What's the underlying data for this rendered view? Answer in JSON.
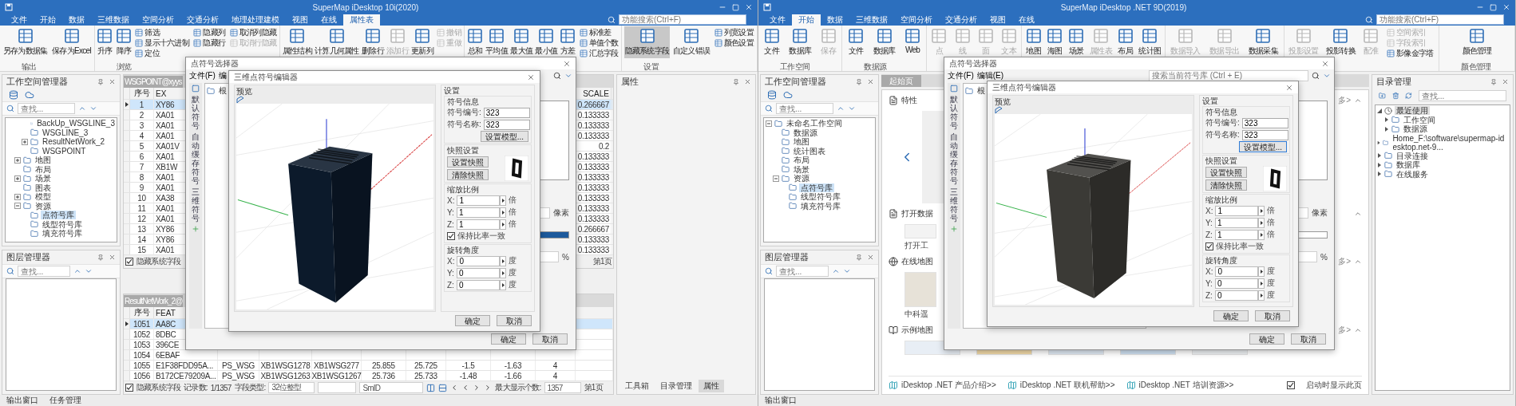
{
  "windows": [
    {
      "kind": "attribute_table",
      "title": "SuperMap iDesktop 10i(2020)",
      "menu_tabs": [
        {
          "label": "文件",
          "selected": false
        },
        {
          "label": "开始",
          "selected": false
        },
        {
          "label": "数据",
          "selected": false
        },
        {
          "label": "三维数据",
          "selected": false
        },
        {
          "label": "空间分析",
          "selected": false
        },
        {
          "label": "交通分析",
          "selected": false
        },
        {
          "label": "地理处理建模",
          "selected": false
        },
        {
          "label": "视图",
          "selected": false
        },
        {
          "label": "在线",
          "selected": false
        },
        {
          "label": "属性表",
          "selected": true
        }
      ],
      "search": {
        "placeholder": "功能搜索(Ctrl+F)"
      },
      "ribbon": [
        {
          "label": "输出",
          "items": [
            {
              "kind": "large",
              "label": "另存为数据集",
              "disabled": false,
              "pressed": false
            },
            {
              "kind": "large",
              "label": "保存为Excel",
              "disabled": false,
              "pressed": false
            }
          ]
        },
        {
          "label": "浏览",
          "items": [
            {
              "kind": "large",
              "label": "升序",
              "disabled": false,
              "pressed": false
            },
            {
              "kind": "large",
              "label": "降序",
              "disabled": false,
              "pressed": false
            },
            {
              "kind": "stack",
              "items": [
                {
                  "label": "筛选",
                  "disabled": false
                },
                {
                  "label": "显示十六进制",
                  "disabled": false
                },
                {
                  "label": "定位",
                  "disabled": false
                }
              ]
            },
            {
              "kind": "stack",
              "items": [
                {
                  "label": "隐藏列",
                  "disabled": false
                },
                {
                  "label": "隐藏行",
                  "disabled": false
                }
              ]
            },
            {
              "kind": "stack",
              "items": [
                {
                  "label": "取消列隐藏",
                  "disabled": false
                },
                {
                  "label": "取消行隐藏",
                  "disabled": true
                }
              ]
            }
          ]
        },
        {
          "items": [
            {
              "kind": "large",
              "label": "属性结构",
              "disabled": false,
              "pressed": false
            },
            {
              "kind": "large",
              "label": "计算几何属性",
              "disabled": false,
              "pressed": false
            },
            {
              "kind": "large",
              "label": "删除行",
              "disabled": false,
              "pressed": false
            },
            {
              "kind": "large",
              "label": "添加行",
              "disabled": true,
              "pressed": false
            },
            {
              "kind": "large",
              "label": "更新列",
              "disabled": false,
              "pressed": false
            },
            {
              "kind": "stack",
              "items": [
                {
                  "label": "撤销",
                  "disabled": true
                },
                {
                  "label": "重做",
                  "disabled": true
                }
              ]
            }
          ]
        },
        {
          "items": [
            {
              "kind": "large",
              "label": "总和",
              "disabled": false,
              "pressed": false
            },
            {
              "kind": "large",
              "label": "平均值",
              "disabled": false,
              "pressed": false
            },
            {
              "kind": "large",
              "label": "最大值",
              "disabled": false,
              "pressed": false
            },
            {
              "kind": "large",
              "label": "最小值",
              "disabled": false,
              "pressed": false
            },
            {
              "kind": "large",
              "label": "方差",
              "disabled": false,
              "pressed": false
            },
            {
              "kind": "stack",
              "items": [
                {
                  "label": "标准差",
                  "disabled": false
                },
                {
                  "label": "单值个数",
                  "disabled": false
                },
                {
                  "label": "汇总字段",
                  "disabled": false
                }
              ]
            }
          ]
        },
        {
          "label": "设置",
          "items": [
            {
              "kind": "large",
              "label": "隐藏系统字段",
              "disabled": false,
              "pressed": true
            },
            {
              "kind": "large",
              "label": "自定义错误",
              "disabled": false,
              "pressed": false
            },
            {
              "kind": "stack",
              "items": [
                {
                  "label": "列宽设置",
                  "disabled": false
                },
                {
                  "label": "颜色设置",
                  "disabled": false
                }
              ]
            }
          ]
        }
      ],
      "workspace_panel": {
        "title": "工作空间管理器",
        "search": {
          "placeholder": "查找..."
        },
        "tree": [
          {
            "children": [
              {
                "children": [
                  {
                    "label": "BackUp_WSGLINE_3",
                    "selected": false
                  },
                  {
                    "label": "WSGLINE_3",
                    "selected": false
                  },
                  {
                    "label": "ResultNetWork_2",
                    "selected": false,
                    "expanded": false
                  },
                  {
                    "label": "WSGPOINT",
                    "selected": false
                  }
                ]
              }
            ]
          },
          {
            "children": [
              {
                "label": "地图",
                "selected": false,
                "expanded": false
              },
              {
                "label": "布局",
                "selected": false
              },
              {
                "label": "场景",
                "selected": false,
                "expanded": false
              },
              {
                "label": "图表",
                "selected": false
              },
              {
                "label": "模型",
                "selected": false,
                "expanded": false
              },
              {
                "label": "资源",
                "selected": false,
                "expanded": true,
                "children": [
                  {
                    "label": "点符号库",
                    "selected": true
                  },
                  {
                    "label": "线型符号库",
                    "selected": false
                  },
                  {
                    "label": "填充符号库",
                    "selected": false
                  }
                ]
              }
            ]
          }
        ]
      },
      "layer_panel": {
        "title": "图层管理器",
        "search": {
          "placeholder": "查找..."
        }
      },
      "center": {
        "tables": [
          {
            "kind": "scale",
            "tab": "WSGPOINT@xyys",
            "columns": [
              "序号",
              "EX",
              "SCALE"
            ],
            "rows": [
              {
                "selected": true,
                "cells": [
                  "1",
                  "XY86",
                  "0.266667"
                ]
              },
              {
                "selected": false,
                "cells": [
                  "2",
                  "XA01",
                  "0.133333"
                ]
              },
              {
                "selected": false,
                "cells": [
                  "3",
                  "XA01",
                  "0.133333"
                ]
              },
              {
                "selected": false,
                "cells": [
                  "4",
                  "XA01",
                  "0.133333"
                ]
              },
              {
                "selected": false,
                "cells": [
                  "5",
                  "XA01V",
                  "0.2"
                ]
              },
              {
                "selected": false,
                "cells": [
                  "6",
                  "XA01",
                  "0.133333"
                ]
              },
              {
                "selected": false,
                "cells": [
                  "7",
                  "XB1W",
                  "0.133333"
                ]
              },
              {
                "selected": false,
                "cells": [
                  "8",
                  "XA01",
                  "0.133333"
                ]
              },
              {
                "selected": false,
                "cells": [
                  "9",
                  "XA01",
                  "0.133333"
                ]
              },
              {
                "selected": false,
                "cells": [
                  "10",
                  "XA38",
                  "0.133333"
                ]
              },
              {
                "selected": false,
                "cells": [
                  "11",
                  "XA01",
                  "0.133333"
                ]
              },
              {
                "selected": false,
                "cells": [
                  "12",
                  "XA01",
                  "0.133333"
                ]
              },
              {
                "selected": false,
                "cells": [
                  "13",
                  "XY86",
                  "0.266667"
                ]
              },
              {
                "selected": false,
                "cells": [
                  "14",
                  "XY86",
                  "0.133333"
                ]
              },
              {
                "selected": false,
                "cells": [
                  "15",
                  "XA01",
                  "0.133333"
                ]
              }
            ],
            "footer": {
              "hide_system_fields": {
                "label": "隐藏系统字段",
                "checked": true
              },
              "page": "第1页"
            }
          },
          {
            "kind": "fields",
            "tab": "ResultNetWork_2@",
            "columns": [
              "序号",
              "FEAT"
            ],
            "rows": [
              {
                "selected": true,
                "cells": [
                  "1051",
                  "AA8C"
                ]
              },
              {
                "selected": false,
                "cells": [
                  "1052",
                  "8DBC"
                ]
              },
              {
                "selected": false,
                "cells": [
                  "1053",
                  "396CE"
                ]
              },
              {
                "selected": false,
                "cells": [
                  "1054",
                  "6EBAF"
                ]
              },
              {
                "selected": false,
                "cells": [
                  "1055",
                  "E1F38FDD95A...",
                  "PS_WSG",
                  "XB1WSG1278",
                  "XB1WSG277",
                  "25.855",
                  "25.725",
                  "-1.5",
                  "-1.63",
                  "4"
                ]
              },
              {
                "selected": false,
                "cells": [
                  "1056",
                  "B172CE79209A...",
                  "PS_WSG",
                  "XB1WSG1263",
                  "XB1WSG1267",
                  "25.736",
                  "25.733",
                  "-1.48",
                  "-1.66",
                  "4"
                ]
              }
            ]
          }
        ],
        "status": {
          "hide_system_fields": {
            "label": "隐藏系统字段",
            "checked": true
          },
          "records_label": "记录数:",
          "records": "1/1357",
          "field_type_label": "字段类型:",
          "field_type": "32位整型",
          "field": "SmID",
          "max_label": "最大显示个数:",
          "max": "1357",
          "page": "第1页"
        }
      },
      "right_panel": {
        "kind": "properties",
        "title": "属性",
        "tabs": [
          {
            "label": "工具箱",
            "selected": false
          },
          {
            "label": "目录管理",
            "selected": false
          },
          {
            "label": "属性",
            "selected": true
          }
        ]
      },
      "bottom_tabs": [
        "输出窗口",
        "任务管理"
      ],
      "selector_dialog": {
        "title": "点符号选择器",
        "menus": [
          "文件(F)",
          "编"
        ],
        "side_tabs": [
          "默认符号",
          "自动缓存符号",
          "三维符号"
        ],
        "tree_root": "根",
        "size_unit": "像素",
        "percent": "%",
        "swatch": {
          "color": "#1d5a9c"
        },
        "buttons": [
          "确定",
          "取消"
        ]
      },
      "editor_dialog": {
        "title": "三维点符号编辑器",
        "preview_label": "预览",
        "model": {
          "color": "#0c1a2b"
        },
        "settings_label": "设置",
        "info": {
          "label": "符号信息",
          "fields": [
            {
              "label": "符号编号:",
              "value": "323"
            },
            {
              "label": "符号名称:",
              "value": "323"
            }
          ],
          "model_button": {
            "label": "设置模型...",
            "focused": false
          }
        },
        "snapshot": {
          "label": "快照设置",
          "buttons": [
            "设置快照",
            "清除快照"
          ]
        },
        "scale": {
          "label": "缩放比例",
          "rows": [
            {
              "axis": "X:",
              "value": "1",
              "unit": "倍"
            },
            {
              "axis": "Y:",
              "value": "1",
              "unit": "倍"
            },
            {
              "axis": "Z:",
              "value": "1",
              "unit": "倍"
            }
          ],
          "keep_ratio": {
            "label": "保持比率一致",
            "checked": true
          }
        },
        "rotation": {
          "label": "旋转角度",
          "rows": [
            {
              "axis": "X:",
              "value": "0",
              "unit": "度"
            },
            {
              "axis": "Y:",
              "value": "0",
              "unit": "度"
            },
            {
              "axis": "Z:",
              "value": "0",
              "unit": "度"
            }
          ]
        },
        "buttons": [
          "确定",
          "取消"
        ]
      }
    },
    {
      "kind": "start_page",
      "title": "SuperMap iDesktop .NET 9D(2019)",
      "menu_tabs": [
        {
          "label": "文件",
          "selected": false
        },
        {
          "label": "开始",
          "selected": true
        },
        {
          "label": "数据",
          "selected": false
        },
        {
          "label": "三维数据",
          "selected": false
        },
        {
          "label": "空间分析",
          "selected": false
        },
        {
          "label": "交通分析",
          "selected": false
        },
        {
          "label": "视图",
          "selected": false
        },
        {
          "label": "在线",
          "selected": false
        }
      ],
      "search": {
        "placeholder": "功能搜索(Ctrl+F)"
      },
      "ribbon": [
        {
          "label": "工作空间",
          "items": [
            {
              "kind": "large",
              "label": "文件",
              "disabled": false,
              "pressed": false
            },
            {
              "kind": "large",
              "label": "数据库",
              "disabled": false,
              "pressed": false
            },
            {
              "kind": "large",
              "label": "保存",
              "disabled": true,
              "pressed": false
            }
          ]
        },
        {
          "label": "数据源",
          "items": [
            {
              "kind": "large",
              "label": "文件",
              "disabled": false,
              "pressed": false
            },
            {
              "kind": "large",
              "label": "数据库",
              "disabled": false,
              "pressed": false
            },
            {
              "kind": "large",
              "label": "Web",
              "disabled": false,
              "pressed": false
            }
          ]
        },
        {
          "items": [
            {
              "kind": "large",
              "label": "点",
              "disabled": true,
              "pressed": false
            },
            {
              "kind": "large",
              "label": "线",
              "disabled": true,
              "pressed": false
            },
            {
              "kind": "large",
              "label": "面",
              "disabled": true,
              "pressed": false
            },
            {
              "kind": "large",
              "label": "文本",
              "disabled": true,
              "pressed": false
            }
          ]
        },
        {
          "items": [
            {
              "kind": "large",
              "label": "地图",
              "disabled": false,
              "pressed": false
            },
            {
              "kind": "large",
              "label": "海图",
              "disabled": false,
              "pressed": false
            },
            {
              "kind": "large",
              "label": "场景",
              "disabled": false,
              "pressed": false
            },
            {
              "kind": "large",
              "label": "属性表",
              "disabled": true,
              "pressed": false
            },
            {
              "kind": "large",
              "label": "布局",
              "disabled": false,
              "pressed": false
            },
            {
              "kind": "large",
              "label": "统计图",
              "disabled": false,
              "pressed": false
            }
          ]
        },
        {
          "items": [
            {
              "kind": "large",
              "label": "数据导入",
              "disabled": true,
              "pressed": false
            },
            {
              "kind": "large",
              "label": "数据导出",
              "disabled": true,
              "pressed": false
            },
            {
              "kind": "large",
              "label": "数据采集",
              "disabled": false,
              "pressed": false
            }
          ]
        },
        {
          "items": [
            {
              "kind": "large",
              "label": "投影设置",
              "disabled": true,
              "pressed": false
            },
            {
              "kind": "large",
              "label": "投影转换",
              "disabled": false,
              "pressed": false
            },
            {
              "kind": "large",
              "label": "配准",
              "disabled": true,
              "pressed": false
            },
            {
              "kind": "stack",
              "items": [
                {
                  "label": "空间索引",
                  "disabled": true
                },
                {
                  "label": "字段索引",
                  "disabled": true
                },
                {
                  "label": "影像金字塔",
                  "disabled": false
                }
              ]
            }
          ]
        },
        {
          "label": "颜色管理",
          "items": [
            {
              "kind": "large",
              "label": "颜色管理",
              "disabled": false,
              "pressed": false
            }
          ]
        }
      ],
      "workspace_panel": {
        "title": "工作空间管理器",
        "search": {
          "placeholder": "查找..."
        },
        "tree": [
          {
            "label": "未命名工作空间",
            "selected": false,
            "expanded": true,
            "children": [
              {
                "label": "数据源",
                "selected": false
              },
              {
                "label": "地图",
                "selected": false
              },
              {
                "label": "统计图表",
                "selected": false
              },
              {
                "label": "布局",
                "selected": false
              },
              {
                "label": "场景",
                "selected": false
              },
              {
                "label": "资源",
                "selected": false,
                "expanded": true,
                "children": [
                  {
                    "label": "点符号库",
                    "selected": true
                  },
                  {
                    "label": "线型符号库",
                    "selected": false
                  },
                  {
                    "label": "填充符号库",
                    "selected": false
                  }
                ]
              }
            ]
          }
        ]
      },
      "layer_panel": {
        "title": "图层管理器",
        "search": {
          "placeholder": "查找..."
        }
      },
      "center": {
        "tab": {
          "label": "起始页",
          "selected": true
        },
        "sections": [
          {
            "kind": "carousel",
            "title": "特性",
            "more": "多>"
          },
          {
            "kind": "items",
            "title": "打开数据",
            "items": [
              "打开工"
            ]
          },
          {
            "kind": "items",
            "title": "在线地图",
            "more": "多>",
            "items": [
              "中科遥"
            ]
          },
          {
            "kind": "maps",
            "title": "示例地图",
            "more": "多>"
          }
        ],
        "links": [
          "iDesktop .NET 产品介绍>>",
          "iDesktop .NET 联机帮助>>",
          "iDesktop .NET 培训资源>>"
        ],
        "show_on_start": {
          "label": "启动时显示此页",
          "checked": true
        }
      },
      "right_panel": {
        "kind": "catalog",
        "title": "目录管理",
        "search": {
          "placeholder": "查找..."
        },
        "tree": [
          {
            "label": "最近使用",
            "selected": true,
            "expanded": true,
            "children": [
              {
                "label": "工作空间",
                "selected": false,
                "expanded": false
              },
              {
                "label": "数据源",
                "selected": false,
                "expanded": false
              }
            ]
          },
          {
            "label": "Home_F:\\software\\supermap-idesktop.net-9...",
            "selected": false,
            "expanded": false
          },
          {
            "label": "目录连接",
            "selected": false,
            "expanded": false
          },
          {
            "label": "数据库",
            "selected": false,
            "expanded": false
          },
          {
            "label": "在线服务",
            "selected": false,
            "expanded": false
          }
        ]
      },
      "bottom_tabs": [
        "输出窗口"
      ],
      "selector_dialog": {
        "title": "点符号选择器",
        "menus": [
          "文件(F)",
          "编辑(E)"
        ],
        "search": {
          "placeholder": "搜索当前符号库 (Ctrl + E)"
        },
        "side_tabs": [
          "默认符号",
          "自动缓存符号",
          "三维符号"
        ],
        "tree_root": "根",
        "size_unit": "像素",
        "percent": "%",
        "swatch": {
          "color": "#ffffff"
        },
        "buttons": [
          "确定",
          "取消"
        ]
      },
      "editor_dialog": {
        "title": "三维点符号编辑器",
        "preview_label": "预览",
        "model": {
          "color": "#3b3a36"
        },
        "settings_label": "设置",
        "info": {
          "label": "符号信息",
          "fields": [
            {
              "label": "符号编号:",
              "value": "323"
            },
            {
              "label": "符号名称:",
              "value": "323"
            }
          ],
          "model_button": {
            "label": "设置模型...",
            "focused": true
          }
        },
        "snapshot": {
          "label": "快照设置",
          "buttons": [
            "设置快照",
            "清除快照"
          ]
        },
        "scale": {
          "label": "缩放比例",
          "rows": [
            {
              "axis": "X:",
              "value": "1",
              "unit": "倍"
            },
            {
              "axis": "Y:",
              "value": "1",
              "unit": "倍"
            },
            {
              "axis": "Z:",
              "value": "1",
              "unit": "倍"
            }
          ],
          "keep_ratio": {
            "label": "保持比率一致",
            "checked": true
          }
        },
        "rotation": {
          "label": "旋转角度",
          "rows": [
            {
              "axis": "X:",
              "value": "0",
              "unit": "度"
            },
            {
              "axis": "Y:",
              "value": "0",
              "unit": "度"
            },
            {
              "axis": "Z:",
              "value": "0",
              "unit": "度"
            }
          ]
        },
        "buttons": [
          "确定",
          "取消"
        ]
      }
    }
  ]
}
